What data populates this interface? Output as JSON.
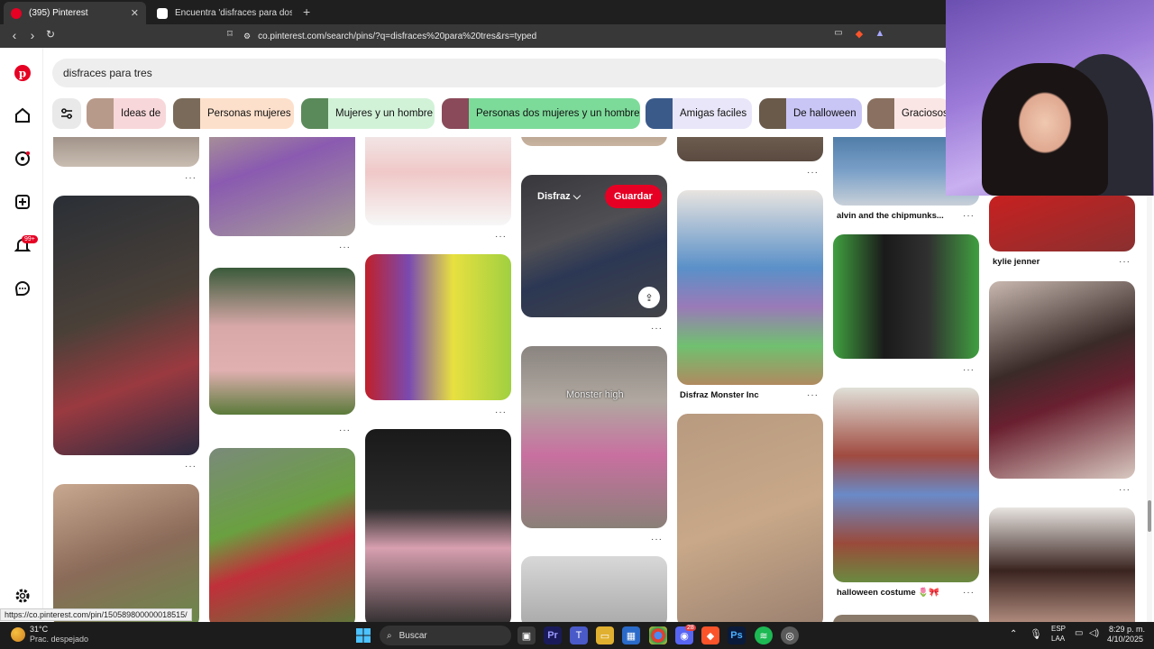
{
  "browser": {
    "tabs": [
      {
        "title": "(395) Pinterest",
        "active": true,
        "color": "#e60023"
      },
      {
        "title": "Encuentra 'disfraces para dos mujere",
        "active": false,
        "color": "#ffffff"
      }
    ],
    "url": "co.pinterest.com/search/pins/?q=disfraces%20para%20tres&rs=typed",
    "status_url": "https://co.pinterest.com/pin/150589800000018515/"
  },
  "sidebar": {
    "notification_badge": "99+"
  },
  "search": {
    "query": "disfraces para tres"
  },
  "chips": [
    {
      "label": "Ideas de",
      "bg": "#f8d7da",
      "thumb": "#b89a8a"
    },
    {
      "label": "Personas mujeres",
      "bg": "#fde0cc",
      "thumb": "#7a6a5a"
    },
    {
      "label": "Mujeres y un hombre",
      "bg": "#d2f2d8",
      "thumb": "#5a8a5a"
    },
    {
      "label": "Personas dos mujeres y un hombre",
      "bg": "#7ddb9a",
      "thumb": "#8a4a5a"
    },
    {
      "label": "Amigas faciles",
      "bg": "#e8e6f8",
      "thumb": "#3a5a8a"
    },
    {
      "label": "De halloween",
      "bg": "#c9c6f5",
      "thumb": "#6a5a4a"
    },
    {
      "label": "Graciosos",
      "bg": "#fbe6e6",
      "thumb": "#8a7060"
    }
  ],
  "pins": {
    "hover": {
      "board": "Disfraz",
      "save": "Guardar"
    },
    "captions": {
      "monster_inc": "Disfraz Monster Inc",
      "chipmunks": "alvin and the chipmunks...",
      "kylie": "kylie jenner",
      "halloween": "halloween costume 🌷🎀"
    },
    "overlay_text": "Monster high"
  },
  "taskbar": {
    "temp": "31°C",
    "weather": "Prac. despejado",
    "search": "Buscar",
    "lang1": "ESP",
    "lang2": "LAA",
    "time": "8:29 p. m.",
    "date": "4/10/2025",
    "badge": "28"
  }
}
